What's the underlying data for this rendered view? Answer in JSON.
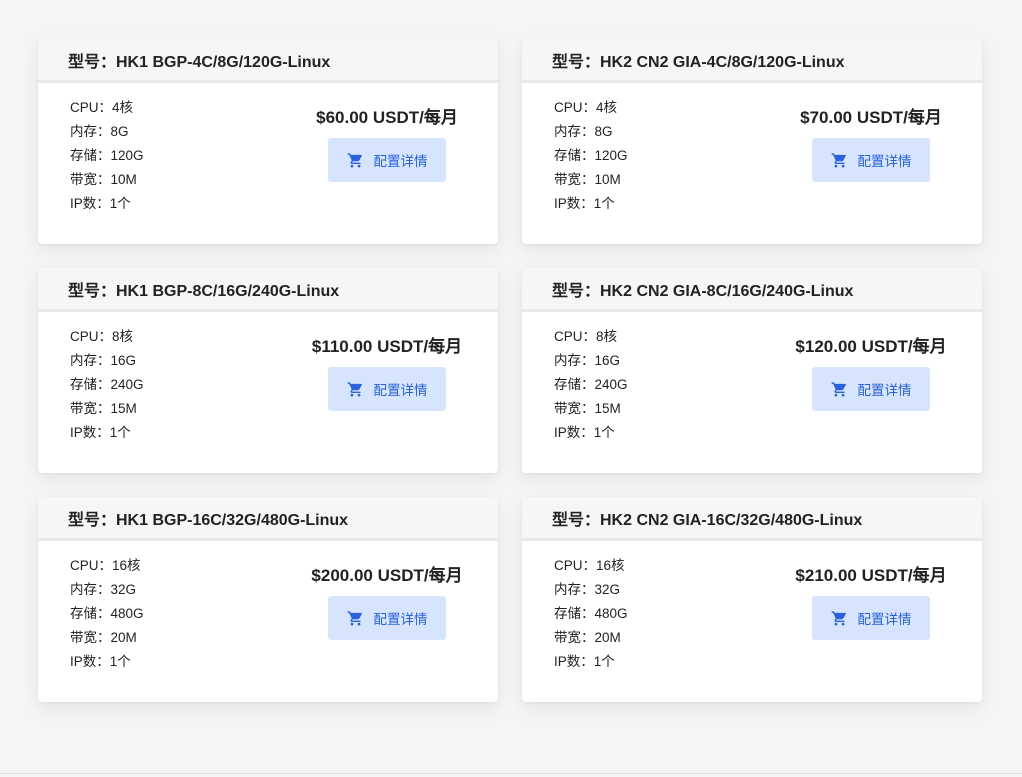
{
  "plans": [
    {
      "title": "型号：HK1 BGP-4C/8G/120G-Linux",
      "specs": [
        "CPU：4核",
        "内存：8G",
        "存储：120G",
        "带宽：10M",
        "IP数：1个"
      ],
      "price": "$60.00 USDT/每月",
      "button_label": "配置详情"
    },
    {
      "title": "型号：HK2 CN2 GIA-4C/8G/120G-Linux",
      "specs": [
        "CPU：4核",
        "内存：8G",
        "存储：120G",
        "带宽：10M",
        "IP数：1个"
      ],
      "price": "$70.00 USDT/每月",
      "button_label": "配置详情"
    },
    {
      "title": "型号：HK1 BGP-8C/16G/240G-Linux",
      "specs": [
        "CPU：8核",
        "内存：16G",
        "存储：240G",
        "带宽：15M",
        "IP数：1个"
      ],
      "price": "$110.00 USDT/每月",
      "button_label": "配置详情"
    },
    {
      "title": "型号：HK2 CN2 GIA-8C/16G/240G-Linux",
      "specs": [
        "CPU：8核",
        "内存：16G",
        "存储：240G",
        "带宽：15M",
        "IP数：1个"
      ],
      "price": "$120.00 USDT/每月",
      "button_label": "配置详情"
    },
    {
      "title": "型号：HK1 BGP-16C/32G/480G-Linux",
      "specs": [
        "CPU：16核",
        "内存：32G",
        "存储：480G",
        "带宽：20M",
        "IP数：1个"
      ],
      "price": "$200.00 USDT/每月",
      "button_label": "配置详情"
    },
    {
      "title": "型号：HK2 CN2 GIA-16C/32G/480G-Linux",
      "specs": [
        "CPU：16核",
        "内存：32G",
        "存储：480G",
        "带宽：20M",
        "IP数：1个"
      ],
      "price": "$210.00 USDT/每月",
      "button_label": "配置详情"
    }
  ],
  "icons": {
    "button_icon": "shopping-cart-icon"
  },
  "colors": {
    "button_bg": "#d6e4fd",
    "button_text": "#2a62d9",
    "header_bg": "#f6f6f6",
    "page_bg": "#f5f5f5"
  }
}
